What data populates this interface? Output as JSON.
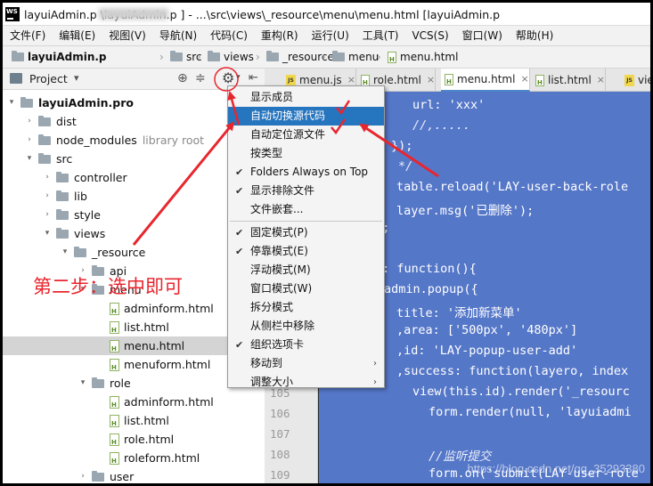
{
  "window": {
    "title": "layuiAdmin.p          \\layuiAdmin.p        ] - ...\\src\\views\\_resource\\menu\\menu.html [layuiAdmin.p",
    "app_icon": "WS"
  },
  "menubar": [
    "文件(F)",
    "编辑(E)",
    "视图(V)",
    "导航(N)",
    "代码(C)",
    "重构(R)",
    "运行(U)",
    "工具(T)",
    "VCS(S)",
    "窗口(W)",
    "帮助(H)"
  ],
  "breadcrumb": {
    "project": "layuiAdmin.p",
    "items": [
      "src",
      "views",
      "_resource",
      "menu",
      "menu.html"
    ]
  },
  "panel": {
    "title": "Project",
    "title_arrow": "▾"
  },
  "tree": [
    {
      "label": "layuiAdmin.pro",
      "bold": true,
      "arrow": "▾",
      "indent": 0,
      "type": "folder"
    },
    {
      "label": "dist",
      "arrow": "›",
      "indent": 1,
      "type": "folder"
    },
    {
      "label": "node_modules",
      "extra": "library root",
      "arrow": "›",
      "indent": 1,
      "type": "folder"
    },
    {
      "label": "src",
      "arrow": "▾",
      "indent": 1,
      "type": "folder"
    },
    {
      "label": "controller",
      "arrow": "›",
      "indent": 2,
      "type": "folder"
    },
    {
      "label": "lib",
      "arrow": "›",
      "indent": 2,
      "type": "folder"
    },
    {
      "label": "style",
      "arrow": "›",
      "indent": 2,
      "type": "folder"
    },
    {
      "label": "views",
      "arrow": "▾",
      "indent": 2,
      "type": "folder"
    },
    {
      "label": "_resource",
      "arrow": "▾",
      "indent": 3,
      "type": "folder"
    },
    {
      "label": "api",
      "arrow": "›",
      "indent": 4,
      "type": "folder"
    },
    {
      "label": "menu",
      "arrow": "▾",
      "indent": 4,
      "type": "folder"
    },
    {
      "label": "adminform.html",
      "indent": 5,
      "type": "html"
    },
    {
      "label": "list.html",
      "indent": 5,
      "type": "html"
    },
    {
      "label": "menu.html",
      "indent": 5,
      "type": "html",
      "selected": true
    },
    {
      "label": "menuform.html",
      "indent": 5,
      "type": "html"
    },
    {
      "label": "role",
      "arrow": "▾",
      "indent": 4,
      "type": "folder"
    },
    {
      "label": "adminform.html",
      "indent": 5,
      "type": "html"
    },
    {
      "label": "list.html",
      "indent": 5,
      "type": "html"
    },
    {
      "label": "role.html",
      "indent": 5,
      "type": "html"
    },
    {
      "label": "roleform.html",
      "indent": 5,
      "type": "html"
    },
    {
      "label": "user",
      "arrow": "›",
      "indent": 4,
      "type": "folder"
    }
  ],
  "tabs": [
    {
      "label": "menu.js",
      "icon": "js"
    },
    {
      "label": "role.html",
      "icon": "html"
    },
    {
      "label": "menu.html",
      "icon": "html",
      "active": true
    },
    {
      "label": "list.html",
      "icon": "html"
    },
    {
      "label": "vie",
      "icon": "js"
    }
  ],
  "popup": {
    "items": [
      {
        "label": "显示成员"
      },
      {
        "label": "自动切换源代码",
        "highlighted": true
      },
      {
        "label": "自动定位源文件"
      },
      {
        "label": "按类型"
      },
      {
        "label": "Folders Always on Top",
        "checked": true
      },
      {
        "label": "显示排除文件",
        "checked": true
      },
      {
        "label": "文件嵌套..."
      },
      {
        "label": "固定模式(P)",
        "checked": true,
        "divider_before": true
      },
      {
        "label": "停靠模式(E)",
        "checked": true
      },
      {
        "label": "浮动模式(M)"
      },
      {
        "label": "窗口模式(W)"
      },
      {
        "label": "拆分模式"
      },
      {
        "label": "从侧栏中移除"
      },
      {
        "label": "组织选项卡",
        "checked": true
      },
      {
        "label": "移动到",
        "submenu": true
      },
      {
        "label": "调整大小",
        "submenu": true
      }
    ]
  },
  "editor": {
    "line_numbers": [
      "105",
      "106",
      "107",
      "108",
      "109"
    ],
    "lines": [
      "url: 'xxx'",
      "//,.....",
      "});",
      "*/",
      "table.reload('LAY-user-back-role",
      "layer.msg('已删除');",
      "});",
      "",
      "d: function(){",
      "admin.popup({",
      "title: '添加新菜单'",
      ",area: ['500px', '480px']",
      ",id: 'LAY-popup-user-add'",
      ",success: function(layero, index",
      "view(this.id).render('_resourc",
      "form.render(null, 'layuiadmi",
      "",
      "//监听提交",
      "form.on('submit(LAY-user-role"
    ],
    "watermark": "https://blog.csdn.net/qq_35293380"
  },
  "annotation": {
    "text": "第二步：选中即可",
    "color": "#e8262e"
  }
}
